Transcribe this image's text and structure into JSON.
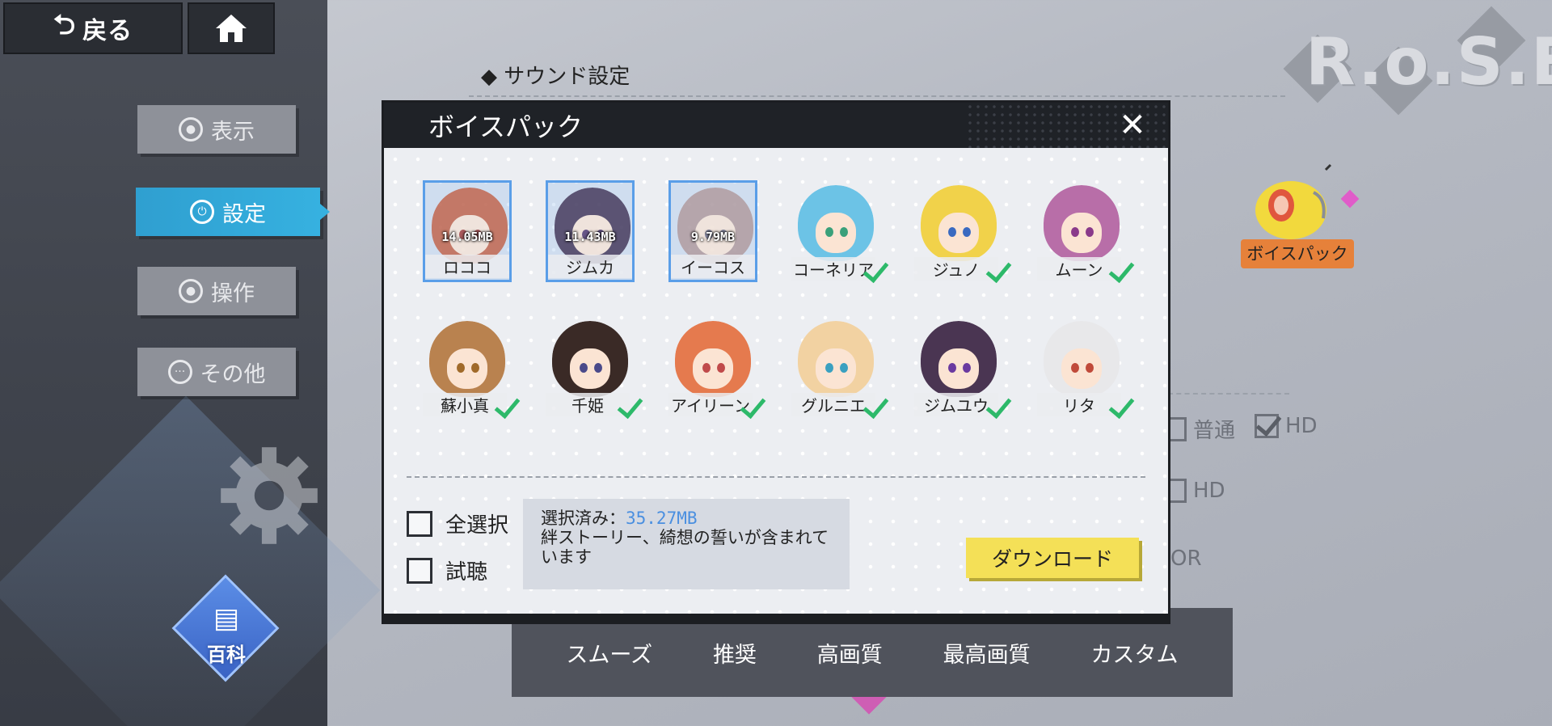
{
  "topbar": {
    "back_label": "戻る"
  },
  "sidebar": {
    "items": [
      {
        "label": "表示"
      },
      {
        "label": "設定"
      },
      {
        "label": "操作"
      },
      {
        "label": "その他"
      }
    ],
    "wiki_label": "百科"
  },
  "main": {
    "section_title": "サウンド設定",
    "logo_text": "R.o.S.E",
    "voice_pack_label": "ボイスパック",
    "bg_options": {
      "normal": "普通",
      "hd1": "HD",
      "hd2": "HD",
      "partial": "OR"
    },
    "quality_options": [
      "スムーズ",
      "推奨",
      "高画質",
      "最高画質",
      "カスタム"
    ]
  },
  "modal": {
    "title": "ボイスパック",
    "characters": [
      {
        "name": "ロココ",
        "size": "14.05MB",
        "selected": true,
        "downloaded": false
      },
      {
        "name": "ジムカ",
        "size": "11.43MB",
        "selected": true,
        "downloaded": false
      },
      {
        "name": "イーコス",
        "size": "9.79MB",
        "selected": true,
        "downloaded": false
      },
      {
        "name": "コーネリア",
        "size": "",
        "selected": false,
        "downloaded": true
      },
      {
        "name": "ジュノ",
        "size": "",
        "selected": false,
        "downloaded": true
      },
      {
        "name": "ムーン",
        "size": "",
        "selected": false,
        "downloaded": true
      },
      {
        "name": "蘇小真",
        "size": "",
        "selected": false,
        "downloaded": true
      },
      {
        "name": "千姫",
        "size": "",
        "selected": false,
        "downloaded": true
      },
      {
        "name": "アイリーン",
        "size": "",
        "selected": false,
        "downloaded": true
      },
      {
        "name": "グルニエ",
        "size": "",
        "selected": false,
        "downloaded": true
      },
      {
        "name": "ジムユウ",
        "size": "",
        "selected": false,
        "downloaded": true
      },
      {
        "name": "リタ",
        "size": "",
        "selected": false,
        "downloaded": true
      }
    ],
    "select_all_label": "全選択",
    "preview_label": "試聴",
    "selected_prefix": "選択済み：",
    "selected_size": "35.27MB",
    "note": "絆ストーリー、綺想の誓いが含まれています",
    "download_label": "ダウンロード"
  },
  "colors": {
    "accent_blue": "#36b1e0",
    "check_green": "#2db96a",
    "download_yellow": "#f4e057",
    "highlight_pink": "#d154b4"
  }
}
